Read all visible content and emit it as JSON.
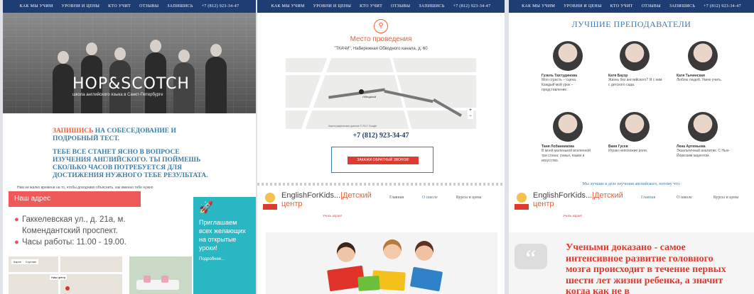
{
  "nav": {
    "items": [
      "КАК МЫ УЧИМ",
      "УРОВНИ И ЦЕНЫ",
      "КТО УЧИТ",
      "ОТЗЫВЫ",
      "ЗАПИШИСЬ",
      "+7 (812) 923-34-47"
    ]
  },
  "panel1": {
    "brand": "HOP&SCOTCH",
    "tagline": "школа английского языка в Санкт-Петербурге",
    "cta_highlight": "ЗАПИШИСЬ",
    "cta_rest": "НА СОБЕСЕДОВАНИЕ И ПОДРОБНЫЙ ТЕСТ.",
    "cta2": "ТЕБЕ ВСЕ СТАНЕТ ЯСНО В ВОПРОСЕ ИЗУЧЕНИЯ АНГЛИЙСКОГО. ТЫ ПОЙМЕШЬ СКОЛЬКО ЧАСОВ ПОТРЕБУЕТСЯ ДЛЯ ДОСТИЖЕНИЯ НУЖНОГО ТЕБЕ РЕЗУЛЬТАТА.",
    "small_note": "Нам не жалко времени на то, чтобы доходчиво объяснить, как именно тебе нужно",
    "address_title": "Наш адрес",
    "address_lines": [
      "Гаккелевская ул., д. 21а, м.",
      "Комендантский проспект.",
      "Часы работы: 11.00 - 19.00."
    ],
    "map_tabs": [
      "Карта",
      "Спутник"
    ],
    "map_label": "Наш центр",
    "promo_text": "Приглашаем всех желающих на открытые уроки!",
    "promo_more": "Подробнее..."
  },
  "panel2": {
    "place_title": "Место проведения",
    "place_address": "\"ТКАЧИ\", Набережная Обводного канала, д. 60",
    "map_marker_label": "Обводный",
    "map_footer": "Картографические данные © 2017 Google",
    "phone": "+7 (812) 923-34-47",
    "callback_button": "ЗАКАЖИ ОБРАТНЫЙ ЗВОНОК!",
    "site_name": "EnglishForKids...",
    "site_name_accent": "|Детский",
    "site_name_line2": "центр",
    "slogan": "Учись играя!",
    "menu": [
      "Главная",
      "О школе",
      "Курсы и цены"
    ]
  },
  "panel3": {
    "title": "ЛУЧШИЕ ПРЕПОДАВАТЕЛИ",
    "teachers": [
      {
        "name": "Гузель Тахтудинова",
        "desc": "Моя страсть – сцена. Каждый мой урок – представление."
      },
      {
        "name": "Катя Баузр",
        "desc": "Жизнь без английского? Я с ним с детского сада."
      },
      {
        "name": "Катя Тычинская",
        "desc": "Люблю людей. Умею учить."
      },
      {
        "name": "Таня Лобанникова",
        "desc": "В моей маленькой вселенной три слона: семья, языки и искусство."
      },
      {
        "name": "Ваня Гусев",
        "desc": "Играю непохожие роли."
      },
      {
        "name": "Лена Артемьева",
        "desc": "Экзальтичный аналитик. С Нью-Йоркским акцентом."
      }
    ],
    "note": "Мы лучшие в деле изучения английского, потому что:",
    "quote": "Учеными доказано - самое интенсивное развитие головного мозга происходит в течение первых шести лет жизни ребенка, а значит когда как не в"
  }
}
